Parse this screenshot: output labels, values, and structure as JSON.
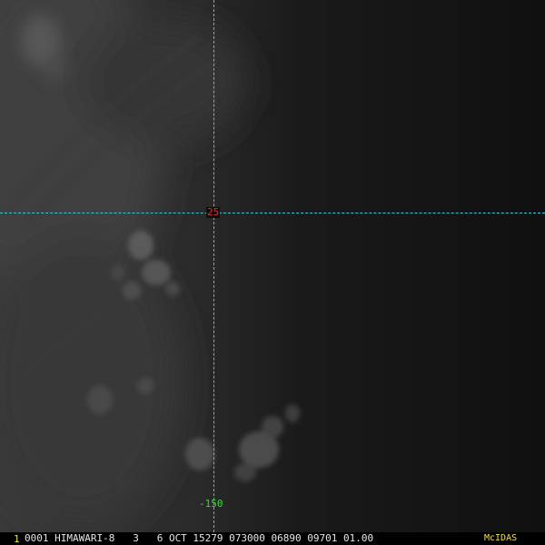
{
  "map": {
    "gridlines": {
      "latitude_label": "25",
      "longitude_label": "-150"
    }
  },
  "status_bar": {
    "frame_number": "1",
    "text": "0001 HIMAWARI-8   3   6 OCT 15279 073000 06890 09701 01.00",
    "brand": "McIDAS"
  },
  "colors": {
    "background": "#0d0d0d",
    "gridline": "#3ec7d6",
    "latitude_label": "#e03030",
    "longitude_label": "#33e033",
    "status_text": "#e6e6e6",
    "frame_number": "#f0e040",
    "brand": "#f0e040"
  }
}
